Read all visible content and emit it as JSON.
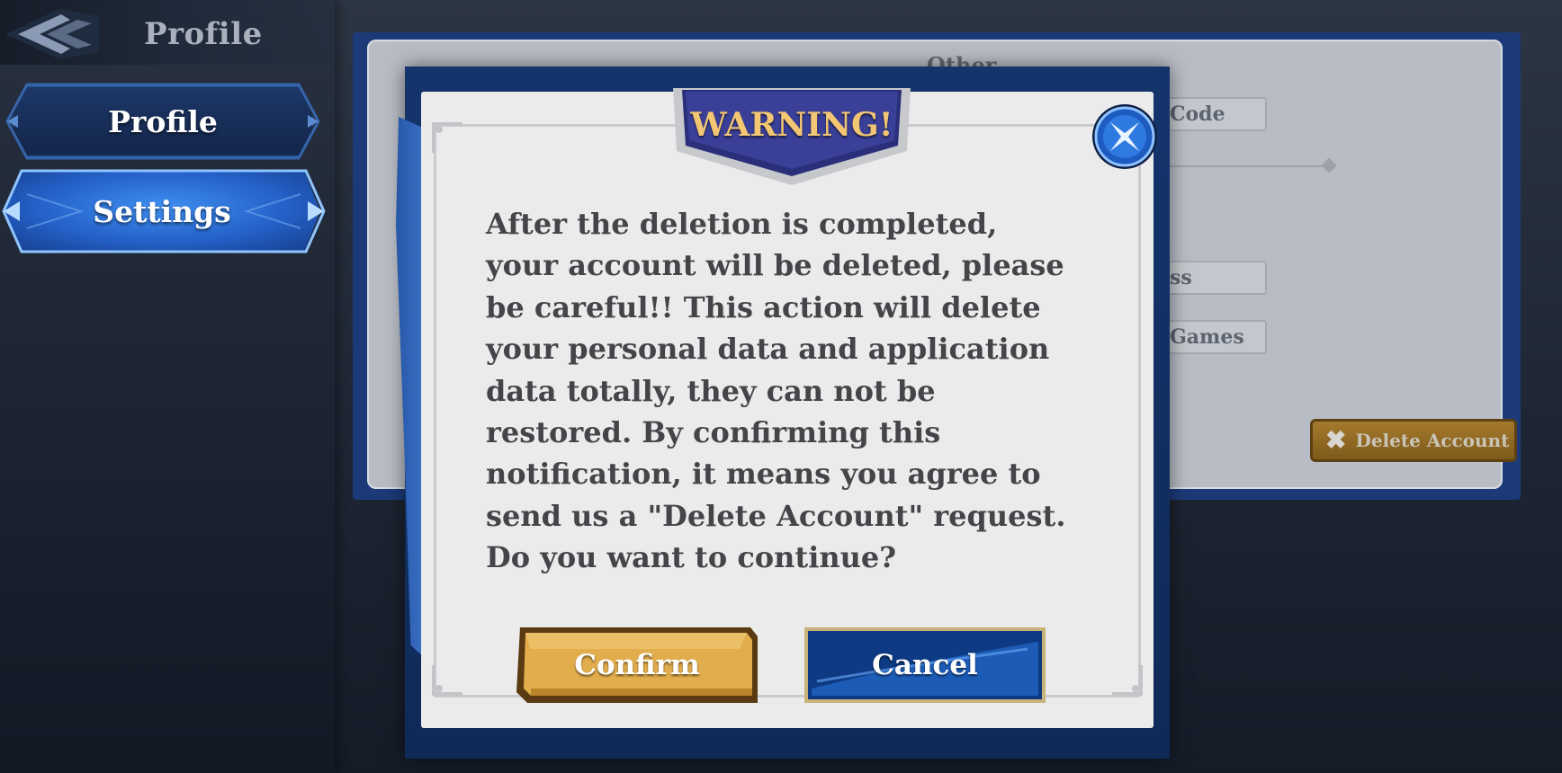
{
  "topbar": {
    "title": "Profile",
    "back_icon": "back-arrow-icon"
  },
  "sidebar": {
    "items": [
      {
        "label": "Profile",
        "active": false
      },
      {
        "label": "Settings",
        "active": true
      }
    ]
  },
  "background_panel": {
    "section_title": "Other",
    "fields": [
      "Code",
      "ss",
      "Games"
    ],
    "delete_button": {
      "label": "Delete Account",
      "icon": "x-icon"
    }
  },
  "dialog": {
    "title": "WARNING!",
    "close_icon": "close-icon",
    "message": "After the deletion is completed, your account will be deleted, please be careful!! This action will delete your personal data and application data totally, they can not be restored. By confirming this notification, it means you agree to send us a \"Delete Account\" request. Do you want to continue?",
    "confirm_label": "Confirm",
    "cancel_label": "Cancel"
  },
  "colors": {
    "dialog_frame": "#14346c",
    "paper": "#ebebec",
    "warning_text": "#f3c674",
    "confirm_gold": "#e2ad4c",
    "cancel_blue": "#1751a5"
  }
}
